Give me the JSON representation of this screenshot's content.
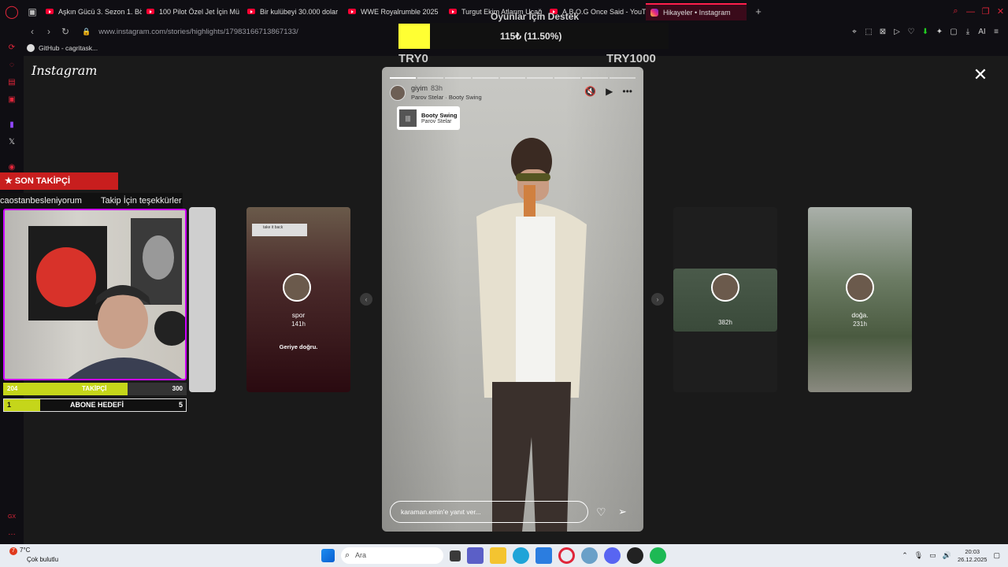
{
  "browser": {
    "tabs": [
      {
        "label": "Aşkın Gücü 3. Sezon 1. Bö",
        "icon": "youtube-icon"
      },
      {
        "label": "100 Pilot Özel Jet İçin Mü",
        "icon": "youtube-icon"
      },
      {
        "label": "Bir kulübeyi 30.000 dolar",
        "icon": "youtube-icon"
      },
      {
        "label": "WWE Royalrumble 2025",
        "icon": "youtube-icon"
      },
      {
        "label": "Turgut Ekim Atlarım Uçağ",
        "icon": "youtube-icon"
      },
      {
        "label": "A.B.O.G Once Said - YouT",
        "icon": "youtube-icon"
      },
      {
        "label": "Hikayeler • Instagram",
        "icon": "instagram-icon",
        "active": true
      }
    ],
    "url": "www.instagram.com/stories/highlights/17983166713867133/",
    "bookmark": "GitHub - cagritask..."
  },
  "instagram": {
    "logo": "Instagram",
    "story": {
      "username": "giyim",
      "time": "83h",
      "song_line": "Parov Stelar · Booty Swing",
      "sticker_title": "Booty Swing",
      "sticker_artist": "Parov Stelar",
      "reply_placeholder": "karaman.emin'e yanıt ver...",
      "segments_total": 9,
      "segments_done": 1
    },
    "previews": [
      {
        "label": "spor",
        "time": "141h",
        "caption": "Geriye doğru."
      },
      {
        "label": "",
        "time": "382h"
      },
      {
        "label": "doğa.",
        "time": "231h"
      }
    ]
  },
  "overlay": {
    "donation_title": "Oyunlar İçin Destek",
    "donation_amount": "115₺ (11.50%)",
    "donation_min": "TRY0",
    "donation_max": "TRY1000",
    "son_takipci": "SON TAKİPÇİ",
    "ticker_1": "caostanbesleniyorum",
    "ticker_2": "Takip İçin teşekkürler k",
    "follow_current": "204",
    "follow_label": "TAKİPÇİ",
    "follow_target": "300",
    "follow_progress": 0.68,
    "sub_current": "1",
    "sub_label": "ABONE HEDEFİ",
    "sub_target": "5",
    "sub_progress": 0.2
  },
  "taskbar": {
    "temp": "7°C",
    "weather": "Çok bulutlu",
    "search_placeholder": "Ara",
    "time": "20:03",
    "date": "26.12.2025"
  },
  "colors": {
    "opera_red": "#e0263a",
    "bar_green": "#c5d61a",
    "donation_yellow": "#ffff33"
  }
}
